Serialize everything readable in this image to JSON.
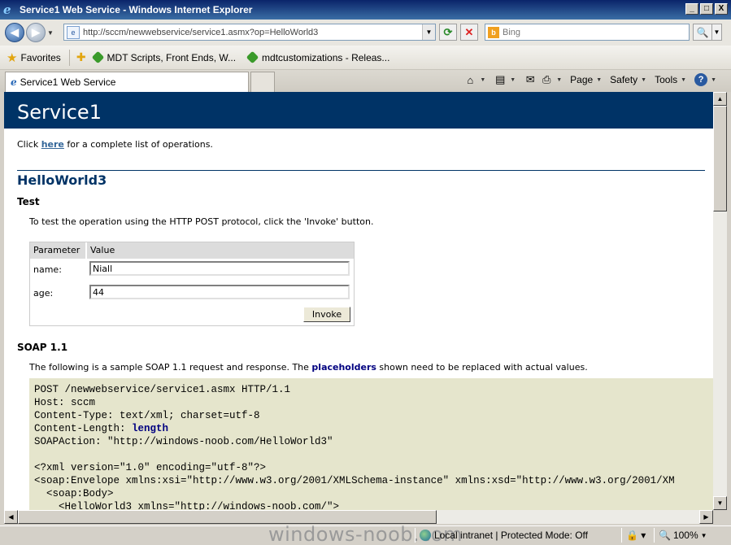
{
  "window": {
    "title": "Service1 Web Service - Windows Internet Explorer",
    "minimize": "_",
    "maximize": "□",
    "close": "X"
  },
  "address_bar": {
    "url": "http://sccm/newwebservice/service1.asmx?op=HelloWorld3",
    "search_placeholder": "Bing"
  },
  "favorites_bar": {
    "label": "Favorites",
    "items": [
      "MDT Scripts, Front Ends, W...",
      "mdtcustomizations - Releas..."
    ]
  },
  "tab": {
    "label": "Service1 Web Service"
  },
  "command_bar": {
    "page": "Page",
    "safety": "Safety",
    "tools": "Tools"
  },
  "page": {
    "service_name": "Service1",
    "intro_before": "Click ",
    "intro_link": "here",
    "intro_after": " for a complete list of operations.",
    "operation_title": "HelloWorld3",
    "test_heading": "Test",
    "test_desc": "To test the operation using the HTTP POST protocol, click the 'Invoke' button.",
    "param_header": "Parameter",
    "value_header": "Value",
    "params": [
      {
        "label": "name:",
        "value": "Niall"
      },
      {
        "label": "age:",
        "value": "44"
      }
    ],
    "invoke_label": "Invoke",
    "soap_heading": "SOAP 1.1",
    "soap_desc_before": "The following is a sample SOAP 1.1 request and response. The ",
    "soap_desc_link": "placeholders",
    "soap_desc_after": " shown need to be replaced with actual values.",
    "code_lines": [
      "POST /newwebservice/service1.asmx HTTP/1.1",
      "Host: sccm",
      "Content-Type: text/xml; charset=utf-8",
      "Content-Length: ",
      "SOAPAction: \"http://windows-noob.com/HelloWorld3\"",
      "",
      "<?xml version=\"1.0\" encoding=\"utf-8\"?>",
      "<soap:Envelope xmlns:xsi=\"http://www.w3.org/2001/XMLSchema-instance\" xmlns:xsd=\"http://www.w3.org/2001/XM",
      "  <soap:Body>",
      "    <HelloWorld3 xmlns=\"http://windows-noob.com/\">"
    ],
    "code_length_placeholder": "length"
  },
  "status_bar": {
    "watermark": "windows-noob.com",
    "zone": "Local intranet | Protected Mode: Off",
    "zoom": "100%"
  }
}
